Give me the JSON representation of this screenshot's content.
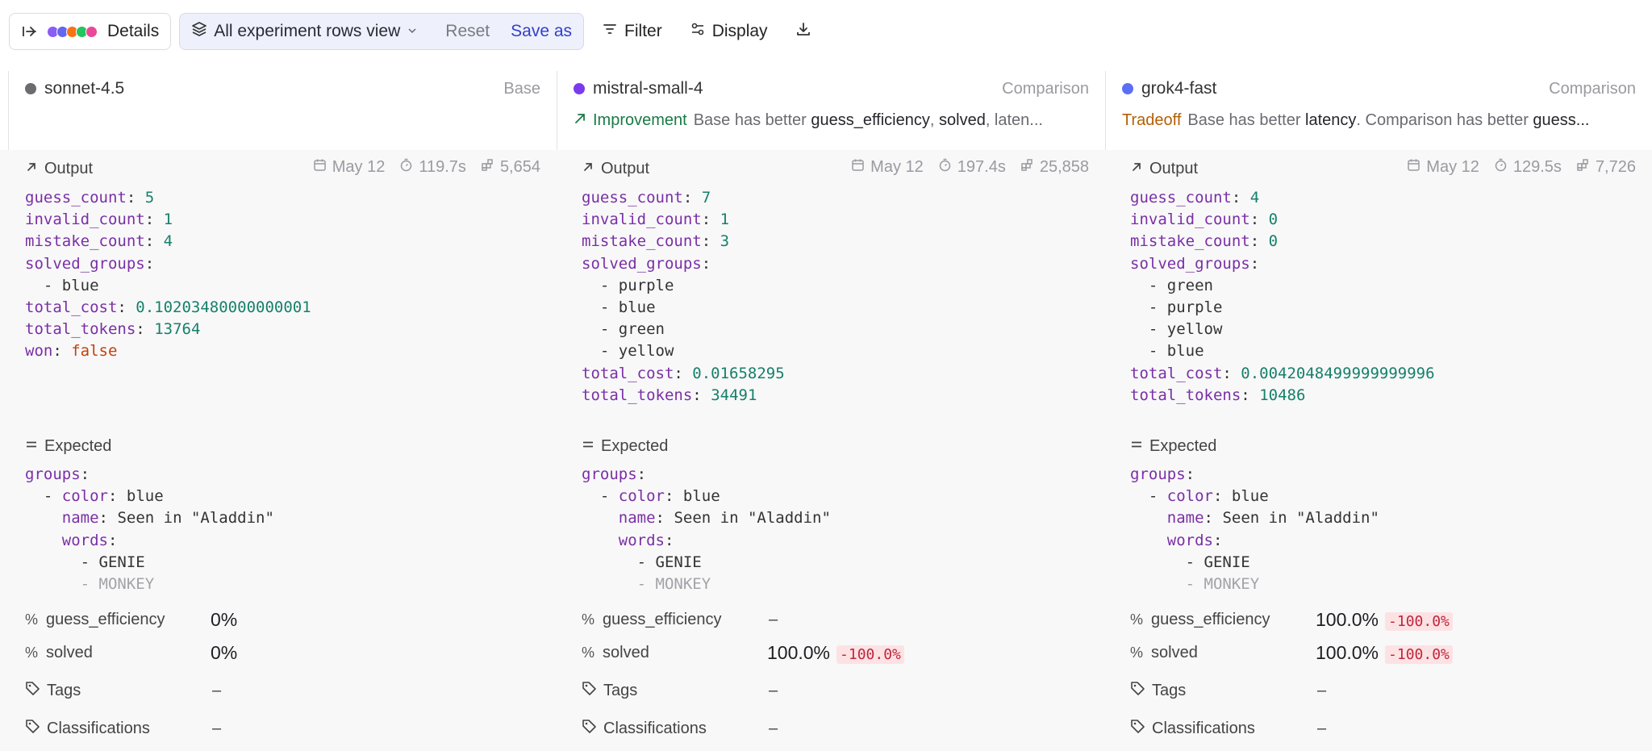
{
  "toolbar": {
    "details_label": "Details",
    "dot_colors": [
      "#8b5cf6",
      "#6366f1",
      "#f97316",
      "#22c55e",
      "#ec4899"
    ],
    "view_label": "All experiment rows view",
    "reset_label": "Reset",
    "saveas_label": "Save as",
    "filter_label": "Filter",
    "display_label": "Display"
  },
  "columns": [
    {
      "model": "sonnet-4.5",
      "dot_color": "#6b6b70",
      "role": "Base",
      "output": {
        "title": "Output",
        "date": "May 12",
        "duration": "119.7s",
        "tokens": "5,654",
        "yaml": [
          {
            "key": "guess_count",
            "val": "5",
            "t": "n"
          },
          {
            "key": "invalid_count",
            "val": "1",
            "t": "n"
          },
          {
            "key": "mistake_count",
            "val": "4",
            "t": "n"
          },
          {
            "key": "solved_groups",
            "val": "",
            "t": "n"
          },
          {
            "item": "blue"
          },
          {
            "key": "total_cost",
            "val": "0.10203480000000001",
            "t": "n"
          },
          {
            "key": "total_tokens",
            "val": "13764",
            "t": "n"
          },
          {
            "key": "won",
            "val": "false",
            "t": "f"
          }
        ]
      },
      "expected": {
        "title": "Expected"
      },
      "metrics": [
        {
          "label": "guess_efficiency",
          "value": "0%",
          "delta": ""
        },
        {
          "label": "solved",
          "value": "0%",
          "delta": ""
        }
      ],
      "tags_label": "Tags",
      "tags_value": "–",
      "class_label": "Classifications",
      "class_value": "–"
    },
    {
      "model": "mistral-small-4",
      "dot_color": "#7c3aed",
      "role": "Comparison",
      "summary": {
        "tag": "Improvement",
        "prefix": "Base has better",
        "b1": "guess_efficiency",
        "mid": ",",
        "b2": "solved",
        "rest": ", laten..."
      },
      "output": {
        "title": "Output",
        "date": "May 12",
        "duration": "197.4s",
        "tokens": "25,858",
        "yaml": [
          {
            "key": "guess_count",
            "val": "7",
            "t": "n"
          },
          {
            "key": "invalid_count",
            "val": "1",
            "t": "n"
          },
          {
            "key": "mistake_count",
            "val": "3",
            "t": "n"
          },
          {
            "key": "solved_groups",
            "val": "",
            "t": "n"
          },
          {
            "item": "purple"
          },
          {
            "item": "blue"
          },
          {
            "item": "green"
          },
          {
            "item": "yellow"
          },
          {
            "key": "total_cost",
            "val": "0.01658295",
            "t": "n"
          },
          {
            "key": "total_tokens",
            "val": "34491",
            "t": "n"
          }
        ]
      },
      "expected": {
        "title": "Expected"
      },
      "metrics": [
        {
          "label": "guess_efficiency",
          "value": "",
          "dash": "–",
          "delta": ""
        },
        {
          "label": "solved",
          "value": "100.0%",
          "delta": "-100.0%"
        }
      ],
      "tags_label": "Tags",
      "tags_value": "–",
      "class_label": "Classifications",
      "class_value": "–"
    },
    {
      "model": "grok4-fast",
      "dot_color": "#5b6ef5",
      "role": "Comparison",
      "summary": {
        "tag": "Tradeoff",
        "prefix": "Base has better",
        "b1": "latency",
        "mid": ". Comparison has better",
        "b2": "guess...",
        "rest": ""
      },
      "output": {
        "title": "Output",
        "date": "May 12",
        "duration": "129.5s",
        "tokens": "7,726",
        "yaml": [
          {
            "key": "guess_count",
            "val": "4",
            "t": "n"
          },
          {
            "key": "invalid_count",
            "val": "0",
            "t": "n"
          },
          {
            "key": "mistake_count",
            "val": "0",
            "t": "n"
          },
          {
            "key": "solved_groups",
            "val": "",
            "t": "n"
          },
          {
            "item": "green"
          },
          {
            "item": "purple"
          },
          {
            "item": "yellow"
          },
          {
            "item": "blue"
          },
          {
            "key": "total_cost",
            "val": "0.0042048499999999996",
            "t": "n"
          },
          {
            "key": "total_tokens",
            "val": "10486",
            "t": "n"
          }
        ]
      },
      "expected": {
        "title": "Expected"
      },
      "metrics": [
        {
          "label": "guess_efficiency",
          "value": "100.0%",
          "delta": "-100.0%"
        },
        {
          "label": "solved",
          "value": "100.0%",
          "delta": "-100.0%"
        }
      ],
      "tags_label": "Tags",
      "tags_value": "–",
      "class_label": "Classifications",
      "class_value": "–"
    }
  ],
  "expected_yaml": {
    "groups_key": "groups",
    "color_key": "color",
    "color_val": "blue",
    "name_key": "name",
    "name_val": "Seen in \"Aladdin\"",
    "words_key": "words",
    "words": [
      "GENIE",
      "MONKEY"
    ]
  }
}
